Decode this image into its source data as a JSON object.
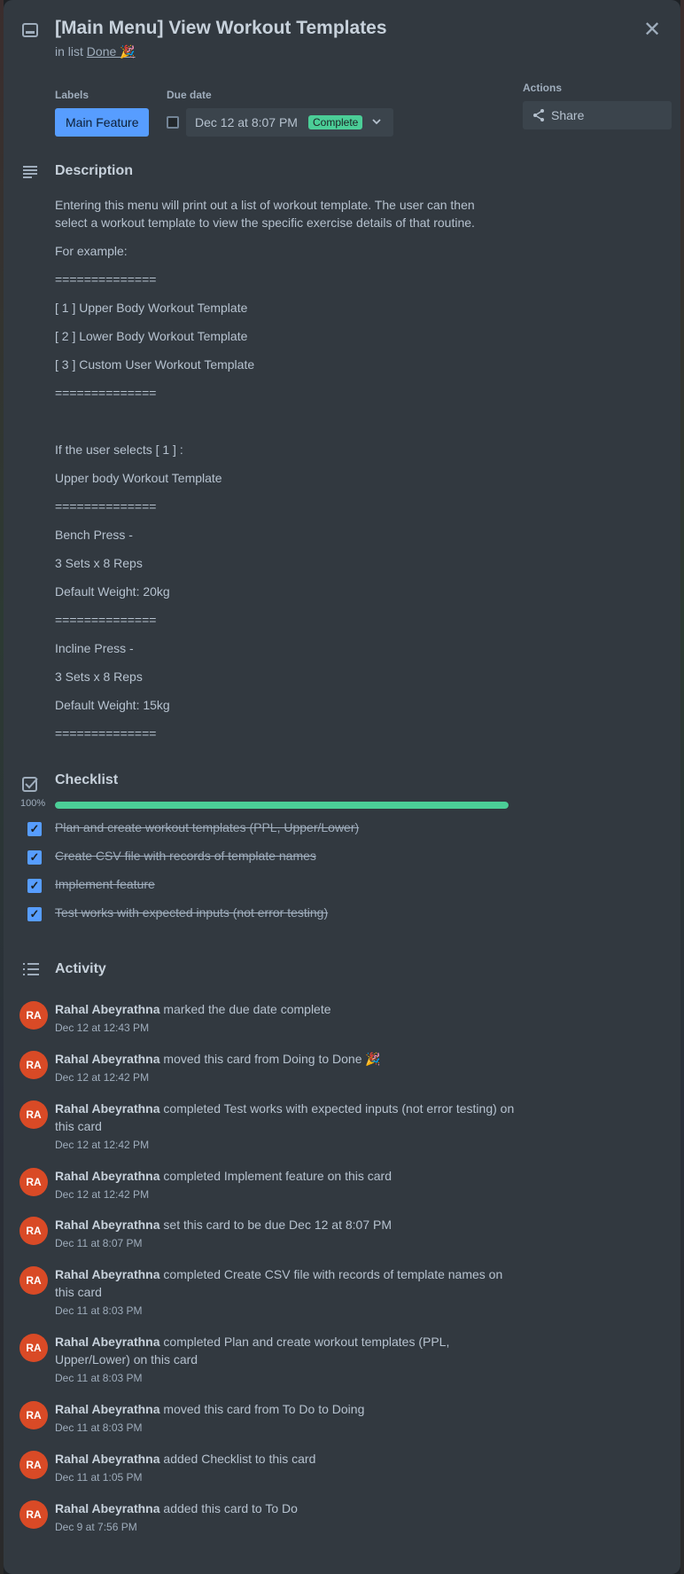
{
  "card": {
    "title": "[Main Menu] View Workout Templates",
    "list_prefix": "in list",
    "list_name": "Done 🎉"
  },
  "labels": {
    "heading": "Labels",
    "items": [
      "Main Feature"
    ],
    "color": "#579dff"
  },
  "due": {
    "heading": "Due date",
    "value": "Dec 12 at 8:07 PM",
    "status": "Complete",
    "status_color": "#4bce97"
  },
  "actions": {
    "heading": "Actions",
    "share_label": "Share"
  },
  "description": {
    "heading": "Description",
    "lines": [
      "Entering this menu will print out a list of workout template. The user can then",
      "select a workout template to view the specific exercise details of that routine.",
      "For example:",
      "==============",
      "[ 1 ] Upper Body Workout Template",
      "[ 2 ] Lower Body Workout Template",
      "[ 3 ] Custom User Workout Template",
      "==============",
      "If the user selects [ 1 ] :",
      "Upper body Workout Template",
      "==============",
      "Bench Press -",
      "3 Sets x 8 Reps",
      "Default Weight: 20kg",
      "==============",
      "Incline Press -",
      "3 Sets x 8 Reps",
      "Default Weight: 15kg",
      "=============="
    ]
  },
  "checklist": {
    "heading": "Checklist",
    "progress_label": "100%",
    "progress": 1.0,
    "items": [
      "Plan and create workout templates (PPL, Upper/Lower)",
      "Create CSV file with records of template names",
      "Implement feature",
      "Test works with expected inputs (not error testing)"
    ]
  },
  "activity": {
    "heading": "Activity",
    "avatar_initials": "RA",
    "avatar_color": "#d94a26",
    "entries": [
      {
        "user": "Rahal Abeyrathna",
        "action": "marked the due date complete",
        "time": "Dec 12 at 12:43 PM"
      },
      {
        "user": "Rahal Abeyrathna",
        "action": "moved this card from Doing to Done 🎉",
        "time": "Dec 12 at 12:42 PM"
      },
      {
        "user": "Rahal Abeyrathna",
        "action": "completed Test works with expected inputs (not error testing) on this card",
        "time": "Dec 12 at 12:42 PM"
      },
      {
        "user": "Rahal Abeyrathna",
        "action": "completed Implement feature on this card",
        "time": "Dec 12 at 12:42 PM"
      },
      {
        "user": "Rahal Abeyrathna",
        "action": "set this card to be due Dec 12 at 8:07 PM",
        "time": "Dec 11 at 8:07 PM"
      },
      {
        "user": "Rahal Abeyrathna",
        "action": "completed Create CSV file with records of template names on this card",
        "time": "Dec 11 at 8:03 PM"
      },
      {
        "user": "Rahal Abeyrathna",
        "action": "completed Plan and create workout templates (PPL, Upper/Lower) on this card",
        "time": "Dec 11 at 8:03 PM"
      },
      {
        "user": "Rahal Abeyrathna",
        "action": "moved this card from To Do to Doing",
        "time": "Dec 11 at 8:03 PM"
      },
      {
        "user": "Rahal Abeyrathna",
        "action": "added Checklist to this card",
        "time": "Dec 11 at 1:05 PM"
      },
      {
        "user": "Rahal Abeyrathna",
        "action": "added this card to To Do",
        "time": "Dec 9 at 7:56 PM"
      }
    ]
  },
  "icons": {
    "card": "card-icon",
    "close": "close-icon",
    "description": "description-icon",
    "checklist": "checklist-icon",
    "activity": "activity-icon",
    "share": "share-icon",
    "chevron": "chevron-down-icon"
  }
}
